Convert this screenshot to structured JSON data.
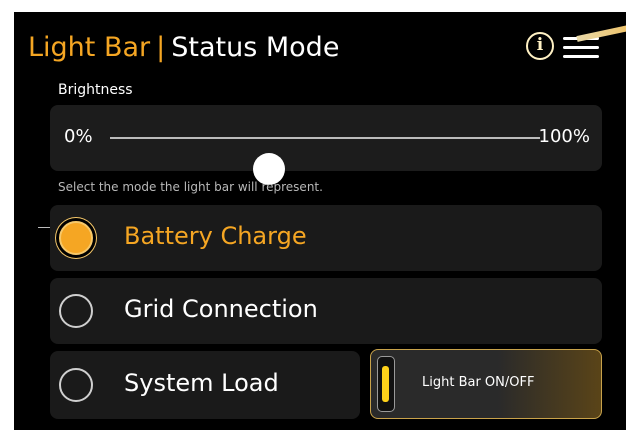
{
  "header": {
    "title_accent": "Light Bar",
    "separator": "|",
    "title_mode": "Status Mode",
    "info_glyph": "i",
    "info_icon": "info-circle-icon",
    "menu_icon": "hamburger-menu-icon"
  },
  "brightness": {
    "label": "Brightness",
    "min_label": "0%",
    "max_label": "100%",
    "value_percent": 37
  },
  "mode_section": {
    "instruction": "Select the mode the light bar will represent.",
    "selected_index": 0,
    "options": [
      {
        "label": "Battery Charge",
        "selected": true
      },
      {
        "label": "Grid Connection",
        "selected": false
      },
      {
        "label": "System Load",
        "selected": false
      }
    ]
  },
  "toggle": {
    "label": "Light Bar ON/OFF",
    "state": "on"
  },
  "colors": {
    "accent": "#f5a623",
    "background": "#000000",
    "panel": "#1c1c1c",
    "indicator_on": "#ffd21a"
  }
}
